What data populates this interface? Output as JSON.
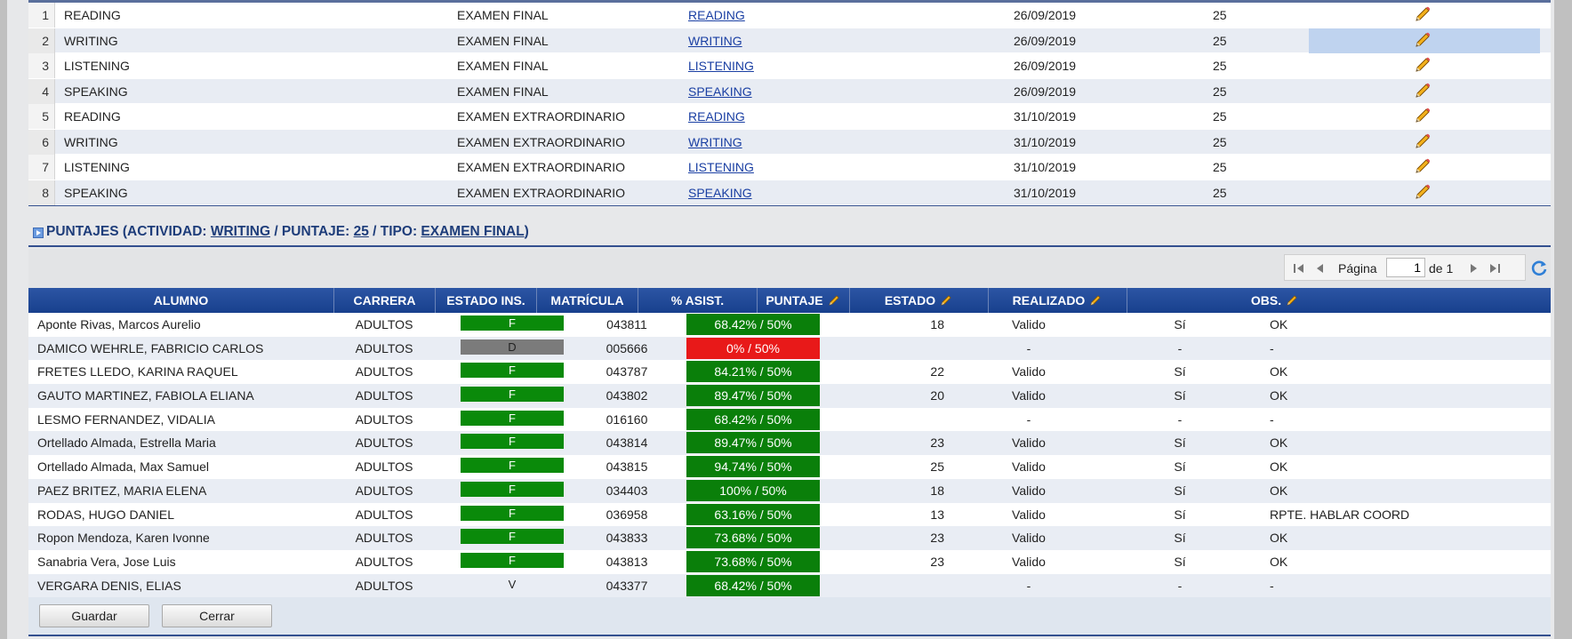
{
  "activities": [
    {
      "num": "1",
      "name": "READING",
      "tipo": "EXAMEN FINAL",
      "link": "READING",
      "fecha": "26/09/2019",
      "puntaje": "25"
    },
    {
      "num": "2",
      "name": "WRITING",
      "tipo": "EXAMEN FINAL",
      "link": "WRITING",
      "fecha": "26/09/2019",
      "puntaje": "25"
    },
    {
      "num": "3",
      "name": "LISTENING",
      "tipo": "EXAMEN FINAL",
      "link": "LISTENING",
      "fecha": "26/09/2019",
      "puntaje": "25"
    },
    {
      "num": "4",
      "name": "SPEAKING",
      "tipo": "EXAMEN FINAL",
      "link": "SPEAKING",
      "fecha": "26/09/2019",
      "puntaje": "25"
    },
    {
      "num": "5",
      "name": "READING",
      "tipo": "EXAMEN EXTRAORDINARIO",
      "link": "READING",
      "fecha": "31/10/2019",
      "puntaje": "25"
    },
    {
      "num": "6",
      "name": "WRITING",
      "tipo": "EXAMEN EXTRAORDINARIO",
      "link": "WRITING",
      "fecha": "31/10/2019",
      "puntaje": "25"
    },
    {
      "num": "7",
      "name": "LISTENING",
      "tipo": "EXAMEN EXTRAORDINARIO",
      "link": "LISTENING",
      "fecha": "31/10/2019",
      "puntaje": "25"
    },
    {
      "num": "8",
      "name": "SPEAKING",
      "tipo": "EXAMEN EXTRAORDINARIO",
      "link": "SPEAKING",
      "fecha": "31/10/2019",
      "puntaje": "25"
    }
  ],
  "section": {
    "prefix": "PUNTAJES (ACTIVIDAD: ",
    "actividad": "WRITING",
    "sep1": " / PUNTAJE: ",
    "puntaje": "25",
    "sep2": " / TIPO: ",
    "tipo": "EXAMEN FINAL",
    "suffix": ")"
  },
  "pager": {
    "page_label": "Página",
    "page_value": "1",
    "of_label": "de 1"
  },
  "columns": {
    "alumno": "ALUMNO",
    "carrera": "CARRERA",
    "estado_ins": "ESTADO INS.",
    "matricula": "MATRÍCULA",
    "asistencia": "% ASIST.",
    "puntaje": "PUNTAJE",
    "estado": "ESTADO",
    "realizado": "REALIZADO",
    "obs": "OBS."
  },
  "students": [
    {
      "alumno": "Aponte Rivas, Marcos Aurelio",
      "carrera": "ADULTOS",
      "estado_ins": "F",
      "matricula": "043811",
      "asist": "68.42% / 50%",
      "asist_ok": true,
      "puntaje": "18",
      "estado": "Valido",
      "realizado": "Sí",
      "obs": "OK"
    },
    {
      "alumno": "DAMICO WEHRLE, FABRICIO CARLOS",
      "carrera": "ADULTOS",
      "estado_ins": "D",
      "matricula": "005666",
      "asist": "0% / 50%",
      "asist_ok": false,
      "puntaje": "",
      "estado": "-",
      "realizado": "-",
      "obs": "-"
    },
    {
      "alumno": "FRETES LLEDO, KARINA RAQUEL",
      "carrera": "ADULTOS",
      "estado_ins": "F",
      "matricula": "043787",
      "asist": "84.21% / 50%",
      "asist_ok": true,
      "puntaje": "22",
      "estado": "Valido",
      "realizado": "Sí",
      "obs": "OK"
    },
    {
      "alumno": "GAUTO MARTINEZ, FABIOLA ELIANA",
      "carrera": "ADULTOS",
      "estado_ins": "F",
      "matricula": "043802",
      "asist": "89.47% / 50%",
      "asist_ok": true,
      "puntaje": "20",
      "estado": "Valido",
      "realizado": "Sí",
      "obs": "OK"
    },
    {
      "alumno": "LESMO FERNANDEZ, VIDALIA",
      "carrera": "ADULTOS",
      "estado_ins": "F",
      "matricula": "016160",
      "asist": "68.42% / 50%",
      "asist_ok": true,
      "puntaje": "",
      "estado": "-",
      "realizado": "-",
      "obs": "-"
    },
    {
      "alumno": "Ortellado Almada, Estrella Maria",
      "carrera": "ADULTOS",
      "estado_ins": "F",
      "matricula": "043814",
      "asist": "89.47% / 50%",
      "asist_ok": true,
      "puntaje": "23",
      "estado": "Valido",
      "realizado": "Sí",
      "obs": "OK"
    },
    {
      "alumno": "Ortellado Almada, Max Samuel",
      "carrera": "ADULTOS",
      "estado_ins": "F",
      "matricula": "043815",
      "asist": "94.74% / 50%",
      "asist_ok": true,
      "puntaje": "25",
      "estado": "Valido",
      "realizado": "Sí",
      "obs": "OK"
    },
    {
      "alumno": "PAEZ BRITEZ, MARIA ELENA",
      "carrera": "ADULTOS",
      "estado_ins": "F",
      "matricula": "034403",
      "asist": "100% / 50%",
      "asist_ok": true,
      "puntaje": "18",
      "estado": "Valido",
      "realizado": "Sí",
      "obs": "OK"
    },
    {
      "alumno": "RODAS, HUGO DANIEL",
      "carrera": "ADULTOS",
      "estado_ins": "F",
      "matricula": "036958",
      "asist": "63.16% / 50%",
      "asist_ok": true,
      "puntaje": "13",
      "estado": "Valido",
      "realizado": "Sí",
      "obs": "RPTE. HABLAR COORD"
    },
    {
      "alumno": "Ropon Mendoza, Karen Ivonne",
      "carrera": "ADULTOS",
      "estado_ins": "F",
      "matricula": "043833",
      "asist": "73.68% / 50%",
      "asist_ok": true,
      "puntaje": "23",
      "estado": "Valido",
      "realizado": "Sí",
      "obs": "OK"
    },
    {
      "alumno": "Sanabria Vera, Jose Luis",
      "carrera": "ADULTOS",
      "estado_ins": "F",
      "matricula": "043813",
      "asist": "73.68% / 50%",
      "asist_ok": true,
      "puntaje": "23",
      "estado": "Valido",
      "realizado": "Sí",
      "obs": "OK"
    },
    {
      "alumno": "VERGARA DENIS, ELIAS",
      "carrera": "ADULTOS",
      "estado_ins": "V",
      "matricula": "043377",
      "asist": "68.42% / 50%",
      "asist_ok": true,
      "puntaje": "",
      "estado": "-",
      "realizado": "-",
      "obs": "-"
    }
  ],
  "footer": {
    "save_label": "Guardar",
    "close_label": "Cerrar"
  },
  "colors": {
    "header_blue": "#18408d",
    "asist_ok": "#0a7f0a",
    "asist_bad": "#e81919",
    "estado_F": "#0a8a0a",
    "estado_D": "#7b7b7b"
  }
}
